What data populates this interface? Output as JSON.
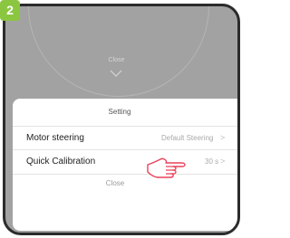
{
  "step_badge": "2",
  "background": {
    "close_label": "Close",
    "chevron_icon": "chevron-down-icon"
  },
  "sheet": {
    "title": "Setting",
    "rows": [
      {
        "label": "Motor steering",
        "value": "Default Steering",
        "chevron": ">"
      },
      {
        "label": "Quick Calibration",
        "value": "30 s",
        "chevron": ">"
      }
    ],
    "close_label": "Close"
  },
  "overlay": {
    "hand_icon": "pointing-hand-icon"
  },
  "colors": {
    "badge": "#8bc640",
    "frame_bg": "#a2a2a2",
    "frame_border": "#2b2b2b"
  }
}
